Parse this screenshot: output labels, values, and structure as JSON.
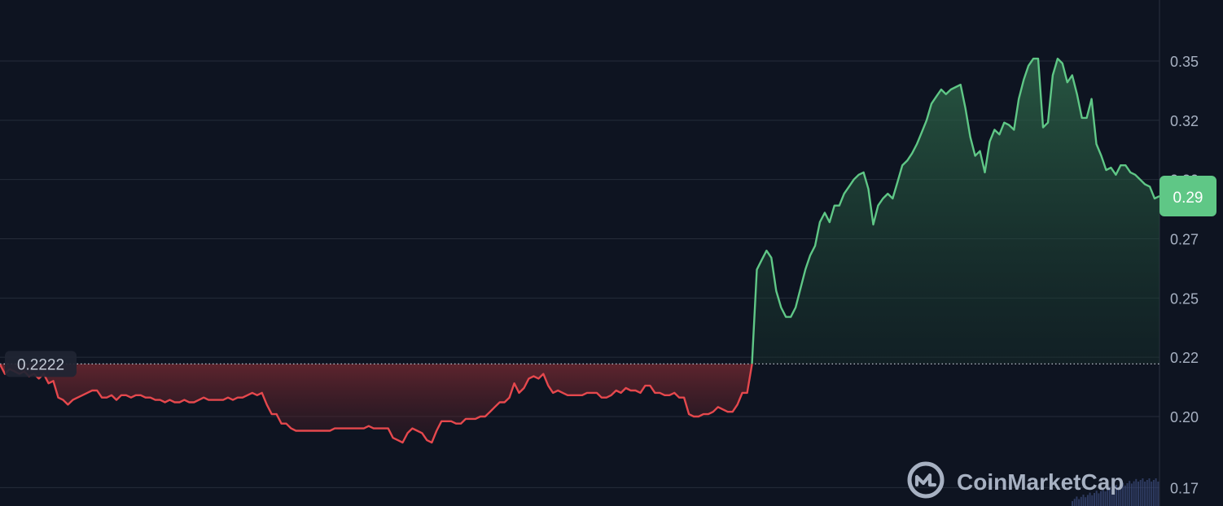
{
  "chart_data": {
    "type": "area",
    "baseline": 0.2222,
    "baseline_label": "0.2222",
    "current_price_label": "0.29",
    "ylim": [
      0.16,
      0.37
    ],
    "y_ticks": [
      0.17,
      0.2,
      0.22,
      0.25,
      0.27,
      0.3,
      0.32,
      0.35
    ],
    "y_tick_labels": [
      "0.17",
      "0.20",
      "0.22",
      "0.25",
      "0.27",
      "0.30",
      "0.32",
      "0.35"
    ],
    "grid": true,
    "colors": {
      "up": "#5fc786",
      "down": "#e5484d",
      "background": "#0e1421",
      "grid": "#2a3040"
    },
    "series": [
      {
        "values": [
          0.222,
          0.218,
          0.22,
          0.219,
          0.218,
          0.219,
          0.217,
          0.218,
          0.216,
          0.218,
          0.214,
          0.215,
          0.208,
          0.207,
          0.205,
          0.207,
          0.208,
          0.209,
          0.21,
          0.211,
          0.211,
          0.208,
          0.208,
          0.209,
          0.207,
          0.209,
          0.209,
          0.208,
          0.209,
          0.209,
          0.208,
          0.208,
          0.207,
          0.207,
          0.206,
          0.207,
          0.206,
          0.206,
          0.207,
          0.206,
          0.206,
          0.207,
          0.208,
          0.207,
          0.207,
          0.207,
          0.207,
          0.208,
          0.207,
          0.208,
          0.208,
          0.209,
          0.21,
          0.209,
          0.21,
          0.205,
          0.201,
          0.201,
          0.197,
          0.197,
          0.195,
          0.194,
          0.194,
          0.194,
          0.194,
          0.194,
          0.194,
          0.194,
          0.194,
          0.195,
          0.195,
          0.195,
          0.195,
          0.195,
          0.195,
          0.195,
          0.196,
          0.195,
          0.195,
          0.195,
          0.195,
          0.191,
          0.19,
          0.189,
          0.193,
          0.195,
          0.194,
          0.193,
          0.19,
          0.189,
          0.194,
          0.198,
          0.198,
          0.198,
          0.197,
          0.197,
          0.199,
          0.199,
          0.199,
          0.2,
          0.2,
          0.202,
          0.204,
          0.206,
          0.206,
          0.208,
          0.214,
          0.21,
          0.212,
          0.216,
          0.217,
          0.216,
          0.218,
          0.213,
          0.21,
          0.211,
          0.21,
          0.209,
          0.209,
          0.209,
          0.209,
          0.21,
          0.21,
          0.21,
          0.208,
          0.208,
          0.209,
          0.211,
          0.21,
          0.212,
          0.211,
          0.211,
          0.21,
          0.213,
          0.213,
          0.21,
          0.21,
          0.209,
          0.209,
          0.21,
          0.208,
          0.208,
          0.201,
          0.2,
          0.2,
          0.201,
          0.201,
          0.202,
          0.204,
          0.203,
          0.202,
          0.202,
          0.205,
          0.21,
          0.21,
          0.222,
          0.262,
          0.266,
          0.27,
          0.267,
          0.253,
          0.246,
          0.242,
          0.242,
          0.246,
          0.254,
          0.262,
          0.268,
          0.272,
          0.282,
          0.286,
          0.282,
          0.289,
          0.289,
          0.294,
          0.297,
          0.3,
          0.302,
          0.303,
          0.296,
          0.281,
          0.289,
          0.292,
          0.294,
          0.292,
          0.299,
          0.306,
          0.308,
          0.311,
          0.315,
          0.32,
          0.325,
          0.332,
          0.335,
          0.338,
          0.336,
          0.338,
          0.339,
          0.34,
          0.33,
          0.318,
          0.31,
          0.312,
          0.303,
          0.316,
          0.321,
          0.319,
          0.324,
          0.323,
          0.321,
          0.334,
          0.342,
          0.348,
          0.351,
          0.351,
          0.322,
          0.324,
          0.344,
          0.351,
          0.349,
          0.341,
          0.344,
          0.336,
          0.326,
          0.326,
          0.334,
          0.315,
          0.31,
          0.304,
          0.305,
          0.302,
          0.306,
          0.306,
          0.303,
          0.302,
          0.3,
          0.298,
          0.297,
          0.292,
          0.293
        ]
      }
    ]
  },
  "brand": {
    "name": "CoinMarketCap",
    "logo_icon": "coinmarketcap-logo-icon"
  }
}
